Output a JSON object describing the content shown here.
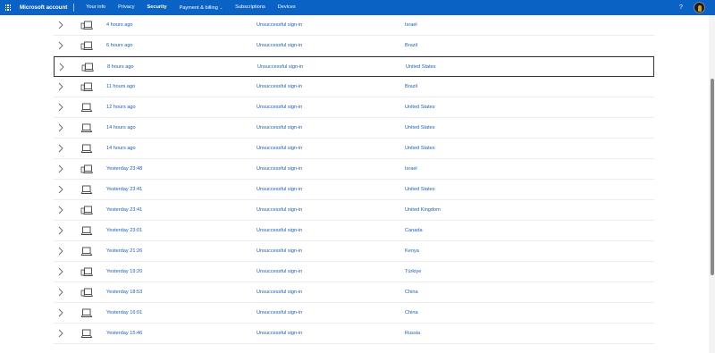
{
  "header": {
    "brand": "Microsoft account",
    "nav": [
      {
        "label": "Your info",
        "active": false
      },
      {
        "label": "Privacy",
        "active": false
      },
      {
        "label": "Security",
        "active": true
      },
      {
        "label": "Payment & billing",
        "active": false,
        "dropdown": true
      },
      {
        "label": "Subscriptions",
        "active": false
      },
      {
        "label": "Devices",
        "active": false
      }
    ],
    "help": "?",
    "icons": {
      "menu": "app-launcher-icon",
      "expand": "chevron-down-icon",
      "avatar": "user-avatar"
    }
  },
  "activity": {
    "row_icons": {
      "expand": "chevron-right-icon",
      "device": "laptop-icon"
    },
    "rows": [
      {
        "time": "4 hours ago",
        "status": "Unsuccessful sign-in",
        "location": "Israel",
        "device": "laptop-phone",
        "selected": false
      },
      {
        "time": "6 hours ago",
        "status": "Unsuccessful sign-in",
        "location": "Brazil",
        "device": "laptop-phone",
        "selected": false
      },
      {
        "time": "8 hours ago",
        "status": "Unsuccessful sign-in",
        "location": "United States",
        "device": "laptop-phone",
        "selected": true
      },
      {
        "time": "11 hours ago",
        "status": "Unsuccessful sign-in",
        "location": "Brazil",
        "device": "laptop-phone",
        "selected": false
      },
      {
        "time": "12 hours ago",
        "status": "Unsuccessful sign-in",
        "location": "United States",
        "device": "laptop",
        "selected": false
      },
      {
        "time": "14 hours ago",
        "status": "Unsuccessful sign-in",
        "location": "United States",
        "device": "laptop",
        "selected": false
      },
      {
        "time": "14 hours ago",
        "status": "Unsuccessful sign-in",
        "location": "United States",
        "device": "laptop",
        "selected": false
      },
      {
        "time": "Yesterday 23:48",
        "status": "Unsuccessful sign-in",
        "location": "Israel",
        "device": "laptop-phone",
        "selected": false
      },
      {
        "time": "Yesterday 23:41",
        "status": "Unsuccessful sign-in",
        "location": "United States",
        "device": "laptop",
        "selected": false
      },
      {
        "time": "Yesterday 23:41",
        "status": "Unsuccessful sign-in",
        "location": "United Kingdom",
        "device": "laptop-phone",
        "selected": false
      },
      {
        "time": "Yesterday 23:01",
        "status": "Unsuccessful sign-in",
        "location": "Canada",
        "device": "laptop",
        "selected": false
      },
      {
        "time": "Yesterday 21:26",
        "status": "Unsuccessful sign-in",
        "location": "Kenya",
        "device": "laptop",
        "selected": false
      },
      {
        "time": "Yesterday 19:20",
        "status": "Unsuccessful sign-in",
        "location": "Türkiye",
        "device": "laptop-phone",
        "selected": false
      },
      {
        "time": "Yesterday 18:53",
        "status": "Unsuccessful sign-in",
        "location": "China",
        "device": "laptop-phone",
        "selected": false
      },
      {
        "time": "Yesterday 16:01",
        "status": "Unsuccessful sign-in",
        "location": "China",
        "device": "laptop",
        "selected": false
      },
      {
        "time": "Yesterday 15:46",
        "status": "Unsuccessful sign-in",
        "location": "Russia",
        "device": "laptop",
        "selected": false
      }
    ]
  },
  "colors": {
    "topbar": "#0a62c4",
    "link": "#1a5fb4",
    "text": "#1f1f1f"
  }
}
